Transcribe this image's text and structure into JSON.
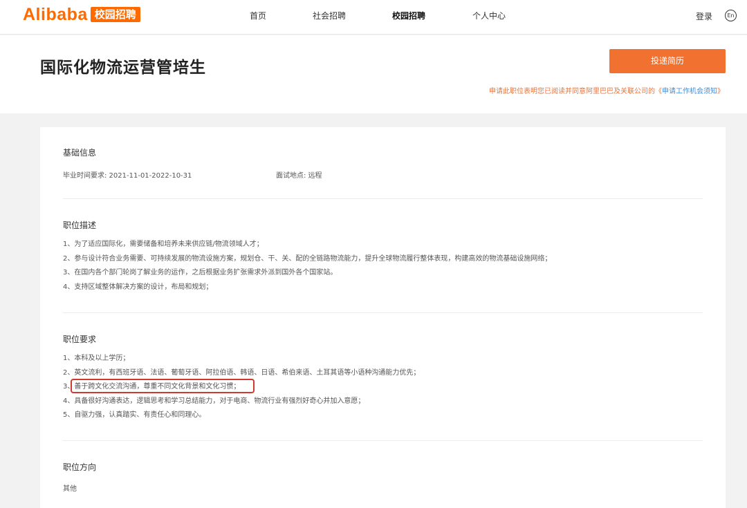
{
  "header": {
    "logo_text": "Alibaba",
    "logo_badge": "校园招聘",
    "nav": [
      "首页",
      "社会招聘",
      "校园招聘",
      "个人中心"
    ],
    "active_nav": "校园招聘",
    "login": "登录",
    "lang": "En"
  },
  "job": {
    "title": "国际化物流运营管培生",
    "apply_label": "投递简历",
    "notice_prefix": "申请此职位表明您已阅读并同意阿里巴巴及关联公司的《",
    "notice_link": "申请工作机会须知",
    "notice_suffix": "》"
  },
  "basic_info": {
    "title": "基础信息",
    "graduation": "毕业时间要求: 2021-11-01-2022-10-31",
    "interview": "面试地点: 远程"
  },
  "description": {
    "title": "职位描述",
    "items": [
      "1、为了适应国际化，需要储备和培养未来供应链/物流领域人才；",
      "2、参与设计符合业务需要、可持续发展的物流设施方案，规划仓、干、关、配的全链路物流能力，提升全球物流履行整体表现，构建高效的物流基础设施网络；",
      "3、在国内各个部门轮岗了解业务的运作，之后根据业务扩张需求外派到国外各个国家站。",
      "4、支持区域整体解决方案的设计，布局和规划；"
    ]
  },
  "requirements": {
    "title": "职位要求",
    "items": [
      "1、本科及以上学历；",
      "2、英文流利，有西班牙语、法语、葡萄牙语、阿拉伯语、韩语、日语、希伯来语、土耳其语等小语种沟通能力优先；",
      "3、善于跨文化交流沟通，尊重不同文化背景和文化习惯；",
      "4、具备很好沟通表达，逻辑思考和学习总结能力，对于电商、物流行业有强烈好奇心并加入意愿；",
      "5、自驱力强，认真踏实、有责任心和同理心。"
    ]
  },
  "direction": {
    "title": "职位方向",
    "value": "其他"
  },
  "colors": {
    "brand": "#ff6a00",
    "button": "#f07130",
    "notice": "#e8743b",
    "link": "#3b8de0",
    "highlight": "#d0392b"
  }
}
